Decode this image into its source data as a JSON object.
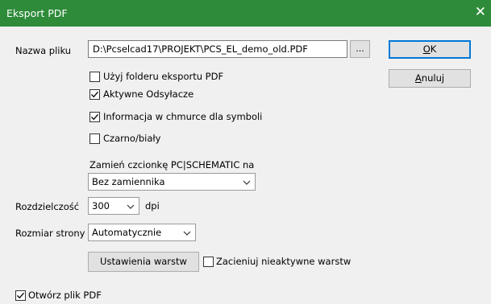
{
  "window": {
    "title": "Eksport PDF",
    "close_glyph": "✕"
  },
  "file": {
    "label": "Nazwa pliku",
    "value": "D:\\Pcselcad17\\PROJEKT\\PCS_EL_demo_old.PDF",
    "browse_label": "..."
  },
  "buttons": {
    "ok_prefix": "",
    "ok_mnemonic": "O",
    "ok_suffix": "K",
    "cancel_prefix": "",
    "cancel_mnemonic": "A",
    "cancel_suffix": "nuluj"
  },
  "options": [
    {
      "label": "Użyj folderu eksportu PDF",
      "checked": false
    },
    {
      "label": "Aktywne Odsyłacze",
      "checked": true
    },
    {
      "label": "Informacja w chmurce dla symboli",
      "checked": true
    },
    {
      "label": "Czarno/biały",
      "checked": false
    }
  ],
  "font_replace": {
    "label": "Zamień czcionkę PC|SCHEMATIC na",
    "selected": "Bez zamiennika"
  },
  "resolution": {
    "label": "Rozdzielczość",
    "selected": "300",
    "unit": "dpi"
  },
  "page_size": {
    "label": "Rozmiar strony",
    "selected": "Automatycznie"
  },
  "layers": {
    "settings_button": "Ustawienia warstw",
    "shade_inactive": {
      "label": "Zacieniuj nieaktywne warstw",
      "checked": false
    }
  },
  "open_pdf": {
    "label": "Otwórz plik PDF",
    "checked": true
  }
}
